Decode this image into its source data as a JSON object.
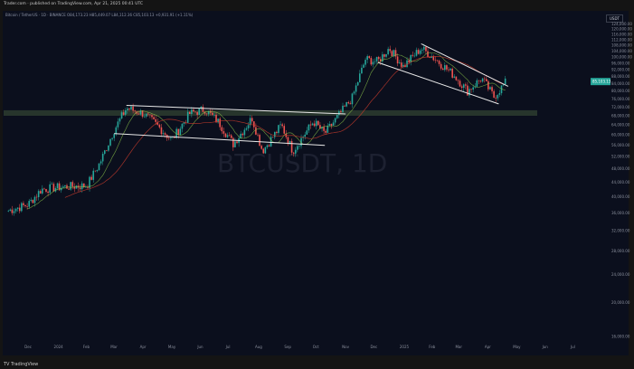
{
  "header": {
    "caption": "Trader.com · published on TradingView.com, Apr 21, 2025 00:41 UTC",
    "ohlc": "Bitcoin / TetherUS · 1D · BINANCE   O84,173.23  H85,449.07  L84,112.36  C85,103.13  +0,931.91 (+1.11%)",
    "quote_tag": "USDT"
  },
  "watermark": "BTCUSDT, 1D",
  "price_label": "85,103.13",
  "footer": {
    "logo": "TV TradingView"
  },
  "colors": {
    "up": "#26a69a",
    "down": "#ef5350",
    "ma_fast": "#8bc34a",
    "ma_slow": "#c0392b",
    "support_band": "#2a3a2f",
    "trendline": "#e8e8e8",
    "price_tag": "#26a69a"
  },
  "chart_data": {
    "type": "candlestick",
    "symbol": "BTCUSDT",
    "interval": "1D",
    "x_ticks": [
      "Dec",
      "2024",
      "Feb",
      "Mar",
      "Apr",
      "May",
      "Jun",
      "Jul",
      "Aug",
      "Sep",
      "Oct",
      "Nov",
      "Dec",
      "2025",
      "Feb",
      "Mar",
      "Apr",
      "May",
      "Jun",
      "Jul"
    ],
    "y_ticks": [
      "124,000.00",
      "120,000.00",
      "116,000.00",
      "112,000.00",
      "108,000.00",
      "104,000.00",
      "100,000.00",
      "96,000.00",
      "92,000.00",
      "88,000.00",
      "84,000.00",
      "80,000.00",
      "76,000.00",
      "72,000.00",
      "68,000.00",
      "64,000.00",
      "60,000.00",
      "56,000.00",
      "52,000.00",
      "48,000.00",
      "44,000.00",
      "40,000.00",
      "36,000.00",
      "32,000.00",
      "28,000.00",
      "24,000.00",
      "20,000.00",
      "16,000.00"
    ],
    "ylim": [
      16000,
      126000
    ],
    "monthly_closes": [
      [
        "2023-11-10",
        36500
      ],
      [
        "2023-12-01",
        38000
      ],
      [
        "2023-12-15",
        42000
      ],
      [
        "2024-01-01",
        42500
      ],
      [
        "2024-01-15",
        42800
      ],
      [
        "2024-02-01",
        43000
      ],
      [
        "2024-02-15",
        50000
      ],
      [
        "2024-03-01",
        62000
      ],
      [
        "2024-03-14",
        71500
      ],
      [
        "2024-04-01",
        69000
      ],
      [
        "2024-04-15",
        64000
      ],
      [
        "2024-05-01",
        58000
      ],
      [
        "2024-05-20",
        69000
      ],
      [
        "2024-06-05",
        71000
      ],
      [
        "2024-06-20",
        65000
      ],
      [
        "2024-07-05",
        56500
      ],
      [
        "2024-07-25",
        67000
      ],
      [
        "2024-08-05",
        54000
      ],
      [
        "2024-08-25",
        64000
      ],
      [
        "2024-09-06",
        54000
      ],
      [
        "2024-09-28",
        65500
      ],
      [
        "2024-10-10",
        60500
      ],
      [
        "2024-10-28",
        70000
      ],
      [
        "2024-11-08",
        76500
      ],
      [
        "2024-11-22",
        98500
      ],
      [
        "2024-12-05",
        97000
      ],
      [
        "2024-12-17",
        106000
      ],
      [
        "2025-01-01",
        94000
      ],
      [
        "2025-01-20",
        106000
      ],
      [
        "2025-02-05",
        98000
      ],
      [
        "2025-02-25",
        88000
      ],
      [
        "2025-03-10",
        80000
      ],
      [
        "2025-03-25",
        87000
      ],
      [
        "2025-04-07",
        77000
      ],
      [
        "2025-04-20",
        85100
      ]
    ],
    "support_band": [
      68000,
      70500
    ],
    "trendlines": [
      {
        "name": "range-top",
        "from": [
          "2024-03-14",
          72800
        ],
        "to": [
          "2024-11-01",
          68800
        ]
      },
      {
        "name": "range-bottom",
        "from": [
          "2024-03-01",
          60500
        ],
        "to": [
          "2024-10-10",
          56000
        ]
      },
      {
        "name": "wedge-top",
        "from": [
          "2025-01-20",
          109000
        ],
        "to": [
          "2025-04-22",
          82500
        ]
      },
      {
        "name": "wedge-bottom",
        "from": [
          "2024-12-05",
          96500
        ],
        "to": [
          "2025-04-12",
          73500
        ]
      }
    ],
    "grid": false,
    "log_scale": true
  }
}
